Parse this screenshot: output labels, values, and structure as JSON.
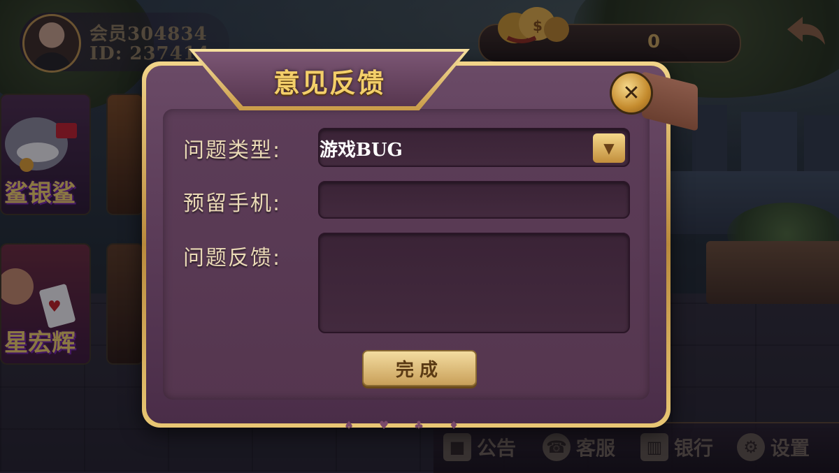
{
  "player": {
    "member_name": "会员304834",
    "id_text": "ID: 237414"
  },
  "wallet": {
    "coins": "0"
  },
  "game_tiles": [
    {
      "label": "鲨银鲨"
    },
    {
      "label": ""
    },
    {
      "label": "星宏辉"
    },
    {
      "label": ""
    }
  ],
  "dialog": {
    "title": "意见反馈",
    "close_glyph": "✕",
    "fields": {
      "type_label": "问题类型:",
      "type_value": "游戏BUG",
      "phone_label": "预留手机:",
      "phone_value": "",
      "feedback_label": "问题反馈:",
      "feedback_value": ""
    },
    "submit_label": "完成",
    "suit_glyphs": [
      "♠",
      "♥",
      "♣",
      "♦"
    ]
  },
  "bottom_nav": [
    {
      "label": "公告",
      "icon": "announcement-icon"
    },
    {
      "label": "客服",
      "icon": "customer-service-icon"
    },
    {
      "label": "银行",
      "icon": "bank-icon"
    },
    {
      "label": "设置",
      "icon": "gear-icon"
    }
  ],
  "colors": {
    "gold": "#f3cf6a",
    "dialog_purple": "#5a3b57",
    "label_text": "#ead9b6"
  }
}
